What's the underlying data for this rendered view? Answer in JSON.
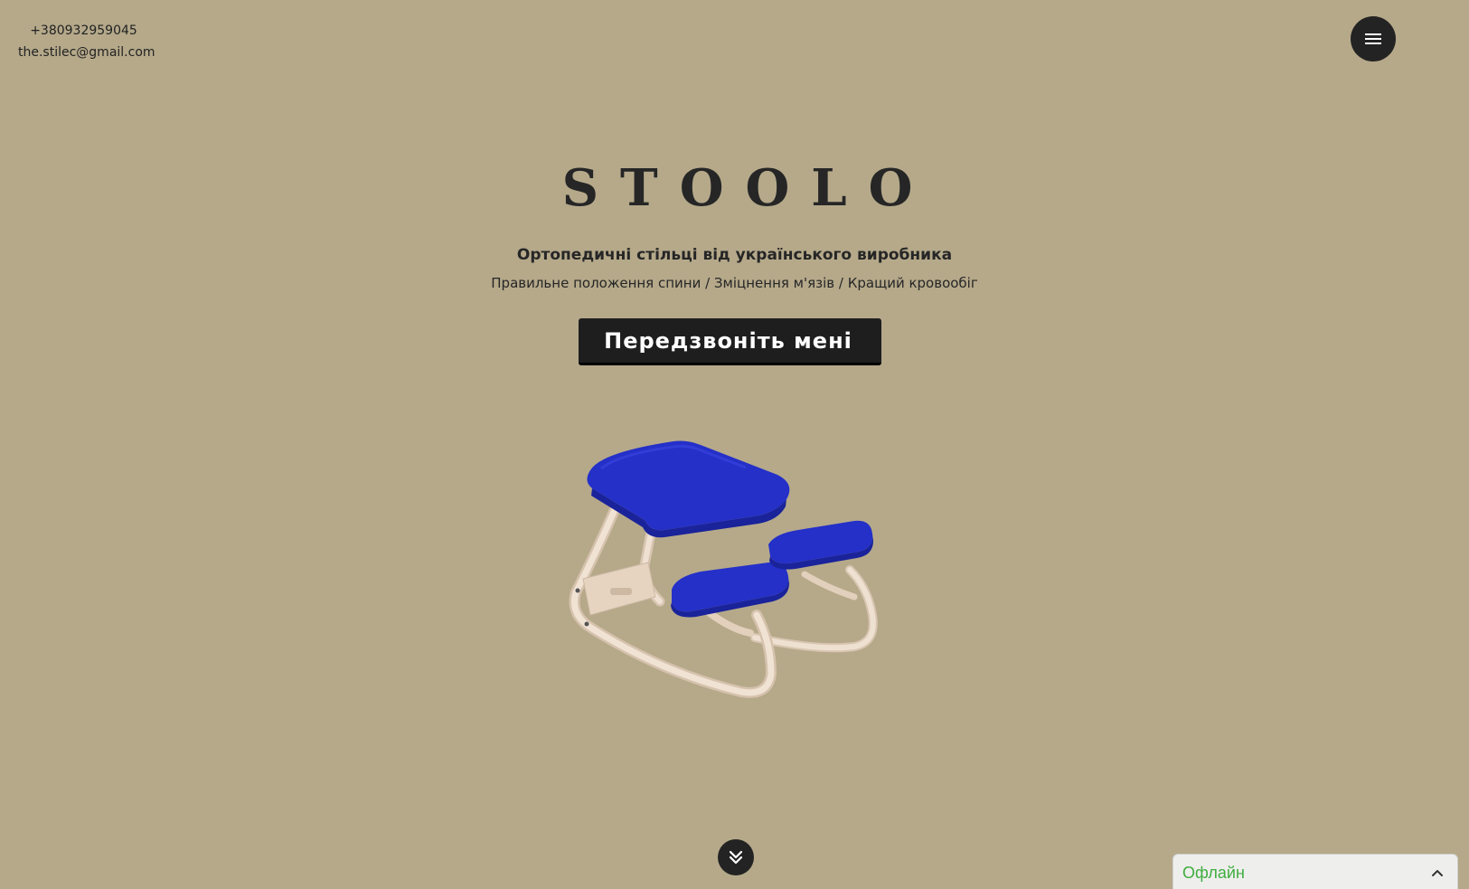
{
  "contacts": {
    "phone": "+380932959045",
    "email": "the.stilec@gmail.com"
  },
  "header": {
    "menu_icon": "hamburger-menu-icon"
  },
  "hero": {
    "brand": "STOOLO",
    "subtitle": "Ортопедичні стільці від українського виробника",
    "benefits": "Правильне положення спини / Зміцнення м'язів / Кращий кровообіг",
    "cta_label": "Передзвоніть мені",
    "product_image": "ergonomic-kneeling-chair-blue"
  },
  "scroll": {
    "icon": "double-chevron-down-icon"
  },
  "chat": {
    "status": "Офлайн",
    "toggle_icon": "chevron-up-icon"
  },
  "colors": {
    "background": "#b5a98a",
    "dark": "#232323",
    "seat_blue": "#2430c8",
    "wood": "#ead8c6",
    "status_green": "#3fae3f"
  }
}
